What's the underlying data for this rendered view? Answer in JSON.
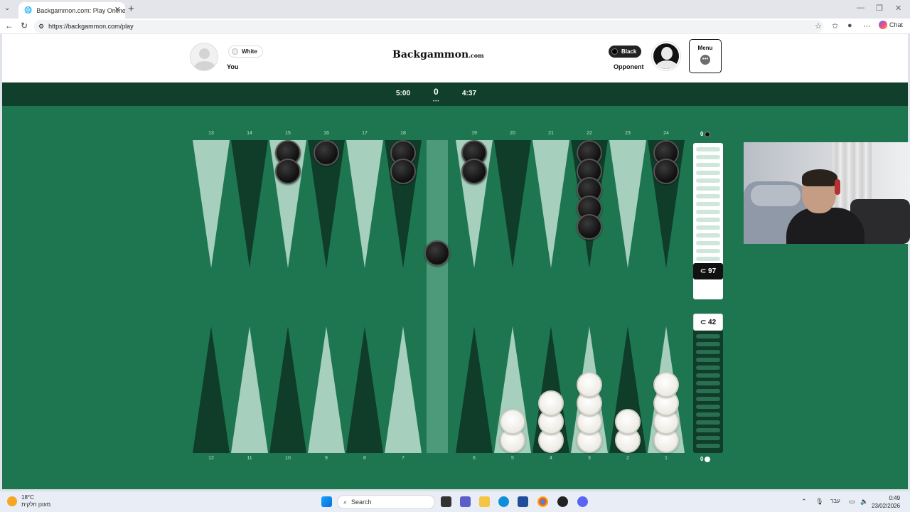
{
  "browser": {
    "tab_title": "Backgammon.com: Play Online Ba",
    "url": "https://backgammon.com/play",
    "chat_label": "Chat"
  },
  "header": {
    "player_color": "White",
    "player_label": "You",
    "logo_main": "Backgammon",
    "logo_suffix": ".com",
    "opponent_color": "Black",
    "opponent_label": "Opponent",
    "menu_label": "Menu"
  },
  "timers": {
    "left": "5:00",
    "score": "0",
    "right": "4:37"
  },
  "board": {
    "top_points": [
      "13",
      "14",
      "15",
      "16",
      "17",
      "18",
      "19",
      "20",
      "21",
      "22",
      "23",
      "24"
    ],
    "bottom_points": [
      "12",
      "11",
      "10",
      "9",
      "8",
      "7",
      "6",
      "5",
      "4",
      "3",
      "2",
      "1"
    ],
    "black_pip": "97",
    "white_pip": "42",
    "black_off": "0",
    "white_off": "0",
    "pip_icon": "⊂",
    "checkers": {
      "black": {
        "15": 2,
        "16": 1,
        "18": 2,
        "19": 2,
        "22": 5,
        "24": 2,
        "bar": 1
      },
      "white": {
        "5": 2,
        "4": 3,
        "3": 4,
        "2": 2,
        "1": 4
      }
    },
    "colors": {
      "felt": "#1e7650",
      "dark_point": "#0f3d29",
      "light_point": "#a6cfbd",
      "bar": "#4c9a79"
    }
  },
  "taskbar": {
    "temperature": "18°C",
    "weather_text": "מעונן חלקית",
    "search_label": "Search",
    "lang": "עבר",
    "time": "0:49",
    "date": "23/02/2026"
  }
}
